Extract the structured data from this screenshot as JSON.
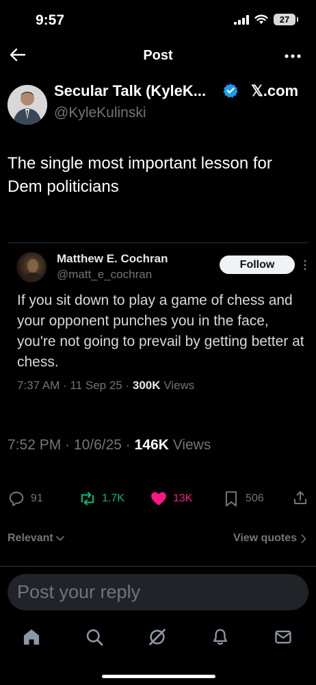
{
  "status_bar": {
    "time": "9:57",
    "battery": "27"
  },
  "header": {
    "title": "Post"
  },
  "post": {
    "author_name": "Secular Talk (KyleK...",
    "source": "𝕏.com",
    "handle": "@KyleKulinski",
    "text": "The single most important lesson for Dem politicians",
    "time": "7:52 PM",
    "date": "10/6/25",
    "views_count": "146K",
    "views_label": "Views"
  },
  "quote": {
    "author_name": "Matthew E. Cochran",
    "handle": "@matt_e_cochran",
    "follow_label": "Follow",
    "text": "If you sit down to play a game of chess and your opponent punches you in the face, you're not going to prevail by getting better at chess.",
    "time": "7:37 AM",
    "date": "11 Sep 25",
    "views_count": "300K",
    "views_label": "Views"
  },
  "actions": {
    "replies": "91",
    "reposts": "1.7K",
    "likes": "13K",
    "bookmarks": "506"
  },
  "sort": {
    "label": "Relevant",
    "quotes_label": "View quotes"
  },
  "reply": {
    "placeholder": "Post your reply"
  },
  "colors": {
    "repost": "#00ba7c",
    "like": "#f91880",
    "verified": "#1d9bf0",
    "muted": "#71767b"
  }
}
